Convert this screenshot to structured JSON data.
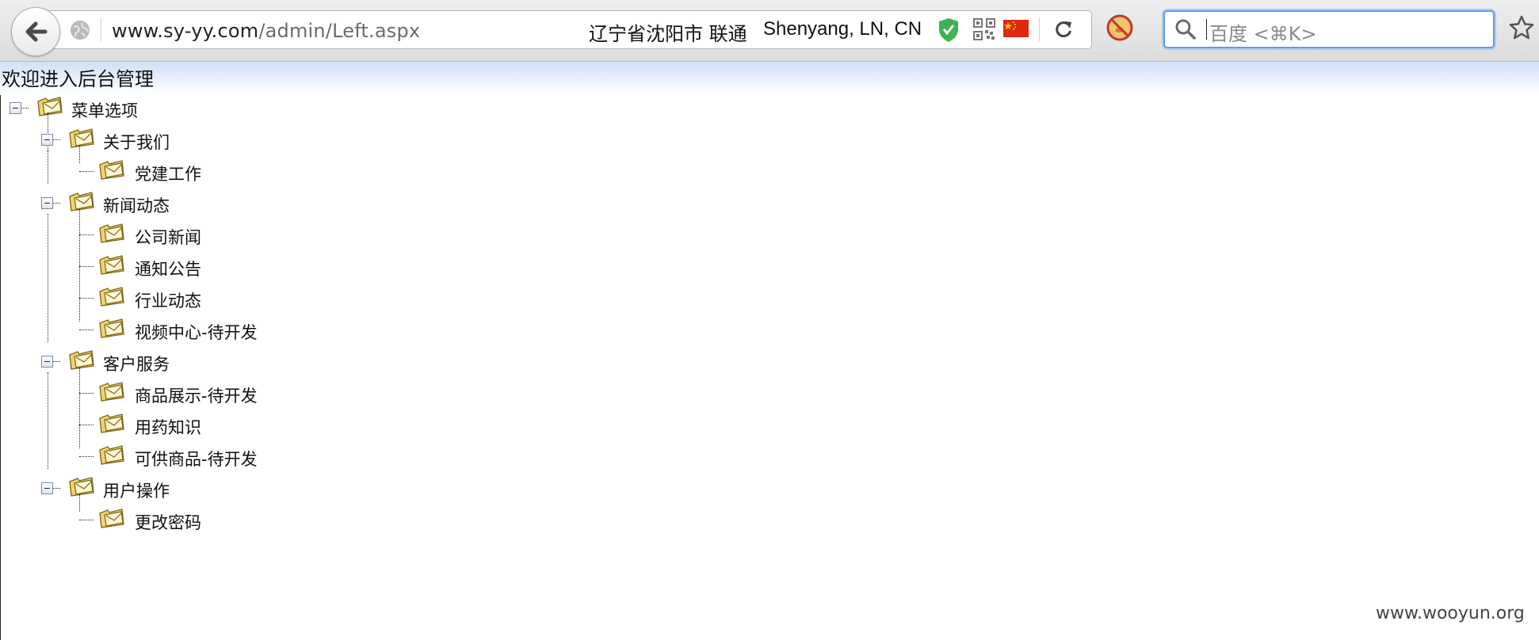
{
  "browser": {
    "url_host": "www.sy-yy.com",
    "url_path": "/admin/Left.aspx",
    "location_cn": "辽宁省沈阳市 联通",
    "location_en": "Shenyang, LN, CN",
    "search_placeholder": "百度 <⌘K>",
    "icons": [
      "back-arrow-icon",
      "globe-icon",
      "shield-check-icon",
      "qr-code-icon",
      "china-flag-icon",
      "reload-icon",
      "adblock-icon",
      "search-icon",
      "bookmark-star-icon"
    ]
  },
  "page": {
    "title": "欢迎进入后台管理",
    "watermark": "www.wooyun.org"
  },
  "tree": {
    "root": "菜单选项",
    "groups": [
      {
        "label": "关于我们",
        "items": [
          "党建工作"
        ]
      },
      {
        "label": "新闻动态",
        "items": [
          "公司新闻",
          "通知公告",
          "行业动态",
          "视频中心-待开发"
        ]
      },
      {
        "label": "客户服务",
        "items": [
          "商品展示-待开发",
          "用药知识",
          "可供商品-待开发"
        ]
      },
      {
        "label": "用户操作",
        "items": [
          "更改密码"
        ]
      }
    ]
  },
  "colors": {
    "search_focus": "#5f9ee8",
    "header_gradient": "#cfe0f7",
    "folder_yellow": "#f3d36b"
  }
}
